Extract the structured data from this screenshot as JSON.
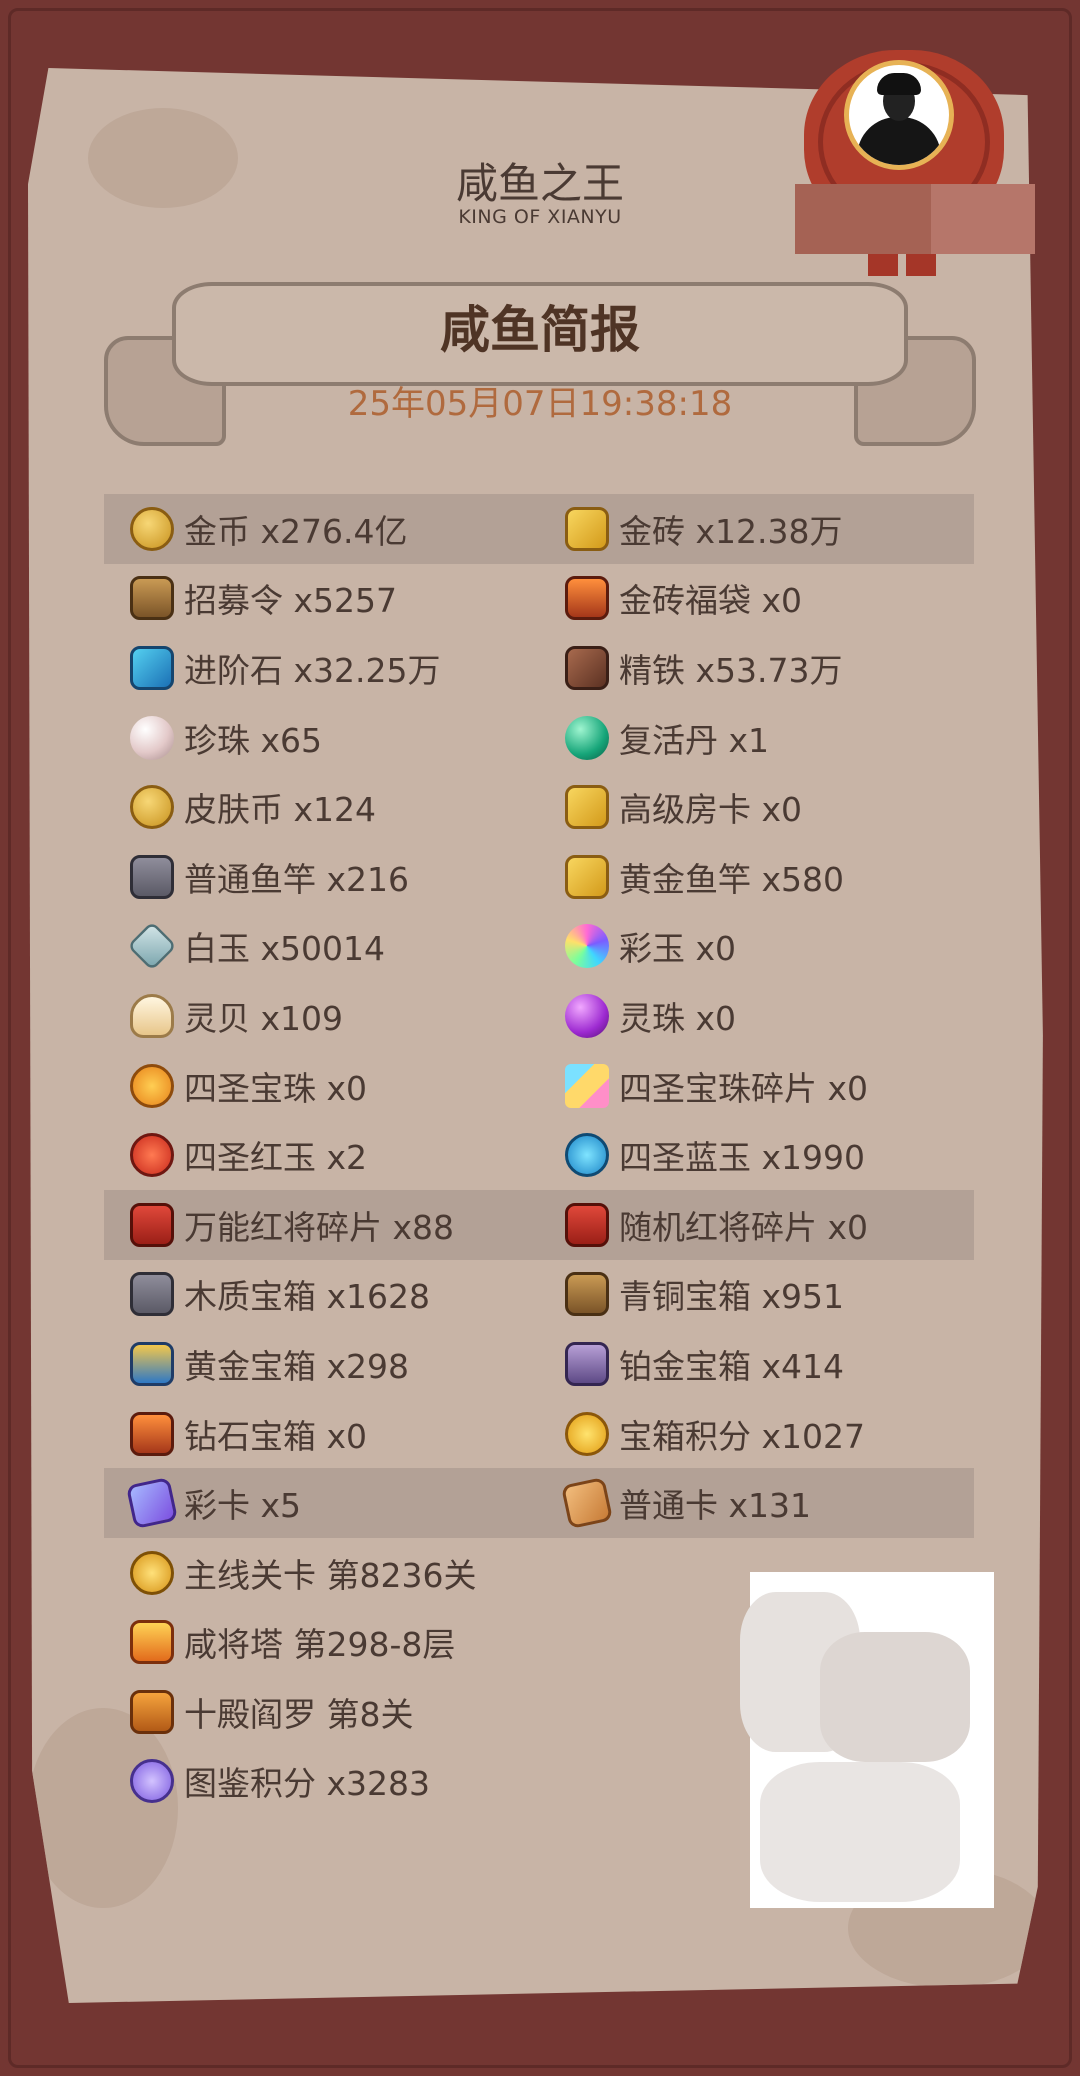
{
  "header": {
    "game_title": "咸鱼之王",
    "game_subtitle": "KING OF XIANYU"
  },
  "report": {
    "title": "咸鱼简报",
    "timestamp": "25年05月07日19:38:18"
  },
  "items": [
    {
      "highlight": true,
      "left": {
        "icon": "gold-coin-icon",
        "text": "金币 x276.4亿"
      },
      "right": {
        "icon": "gold-brick-icon",
        "text": "金砖 x12.38万"
      }
    },
    {
      "highlight": false,
      "left": {
        "icon": "recruit-token-icon",
        "text": "招募令 x5257"
      },
      "right": {
        "icon": "gold-brick-bag-icon",
        "text": "金砖福袋 x0"
      }
    },
    {
      "highlight": false,
      "left": {
        "icon": "advance-stone-icon",
        "text": "进阶石 x32.25万"
      },
      "right": {
        "icon": "refined-iron-icon",
        "text": "精铁 x53.73万"
      }
    },
    {
      "highlight": false,
      "left": {
        "icon": "pearl-icon",
        "text": "珍珠 x65"
      },
      "right": {
        "icon": "revive-pill-icon",
        "text": "复活丹 x1"
      }
    },
    {
      "highlight": false,
      "left": {
        "icon": "skin-coin-icon",
        "text": "皮肤币 x124"
      },
      "right": {
        "icon": "premium-room-card-icon",
        "text": "高级房卡 x0"
      }
    },
    {
      "highlight": false,
      "left": {
        "icon": "fishing-rod-icon",
        "text": "普通鱼竿 x216"
      },
      "right": {
        "icon": "golden-rod-icon",
        "text": "黄金鱼竿 x580"
      }
    },
    {
      "highlight": false,
      "left": {
        "icon": "white-jade-icon",
        "text": "白玉 x50014"
      },
      "right": {
        "icon": "rainbow-jade-icon",
        "text": "彩玉 x0"
      }
    },
    {
      "highlight": false,
      "left": {
        "icon": "spirit-shell-icon",
        "text": "灵贝 x109"
      },
      "right": {
        "icon": "spirit-orb-icon",
        "text": "灵珠 x0"
      }
    },
    {
      "highlight": false,
      "left": {
        "icon": "holy-orb-icon",
        "text": "四圣宝珠 x0"
      },
      "right": {
        "icon": "holy-orb-shard-icon",
        "text": "四圣宝珠碎片 x0"
      }
    },
    {
      "highlight": false,
      "left": {
        "icon": "holy-red-jade-icon",
        "text": "四圣红玉 x2"
      },
      "right": {
        "icon": "holy-blue-jade-icon",
        "text": "四圣蓝玉 x1990"
      }
    },
    {
      "highlight": true,
      "left": {
        "icon": "universal-general-shard-icon",
        "text": "万能红将碎片 x88"
      },
      "right": {
        "icon": "random-general-shard-icon",
        "text": "随机红将碎片 x0"
      }
    },
    {
      "highlight": false,
      "left": {
        "icon": "wooden-chest-icon",
        "text": "木质宝箱 x1628"
      },
      "right": {
        "icon": "bronze-chest-icon",
        "text": "青铜宝箱 x951"
      }
    },
    {
      "highlight": false,
      "left": {
        "icon": "gold-chest-icon",
        "text": "黄金宝箱 x298"
      },
      "right": {
        "icon": "platinum-chest-icon",
        "text": "铂金宝箱 x414"
      }
    },
    {
      "highlight": false,
      "left": {
        "icon": "diamond-chest-icon",
        "text": "钻石宝箱 x0"
      },
      "right": {
        "icon": "chest-points-icon",
        "text": "宝箱积分 x1027"
      }
    },
    {
      "highlight": true,
      "left": {
        "icon": "color-card-icon",
        "text": "彩卡 x5"
      },
      "right": {
        "icon": "normal-card-icon",
        "text": "普通卡 x131"
      }
    },
    {
      "highlight": false,
      "left": {
        "icon": "main-stage-icon",
        "text": "主线关卡 第8236关"
      },
      "right": null
    },
    {
      "highlight": false,
      "left": {
        "icon": "general-tower-icon",
        "text": "咸将塔 第298-8层"
      },
      "right": null
    },
    {
      "highlight": false,
      "left": {
        "icon": "yama-icon",
        "text": "十殿阎罗 第8关"
      },
      "right": null
    },
    {
      "highlight": false,
      "left": {
        "icon": "codex-points-icon",
        "text": "图鉴积分 x3283"
      },
      "right": null
    }
  ]
}
